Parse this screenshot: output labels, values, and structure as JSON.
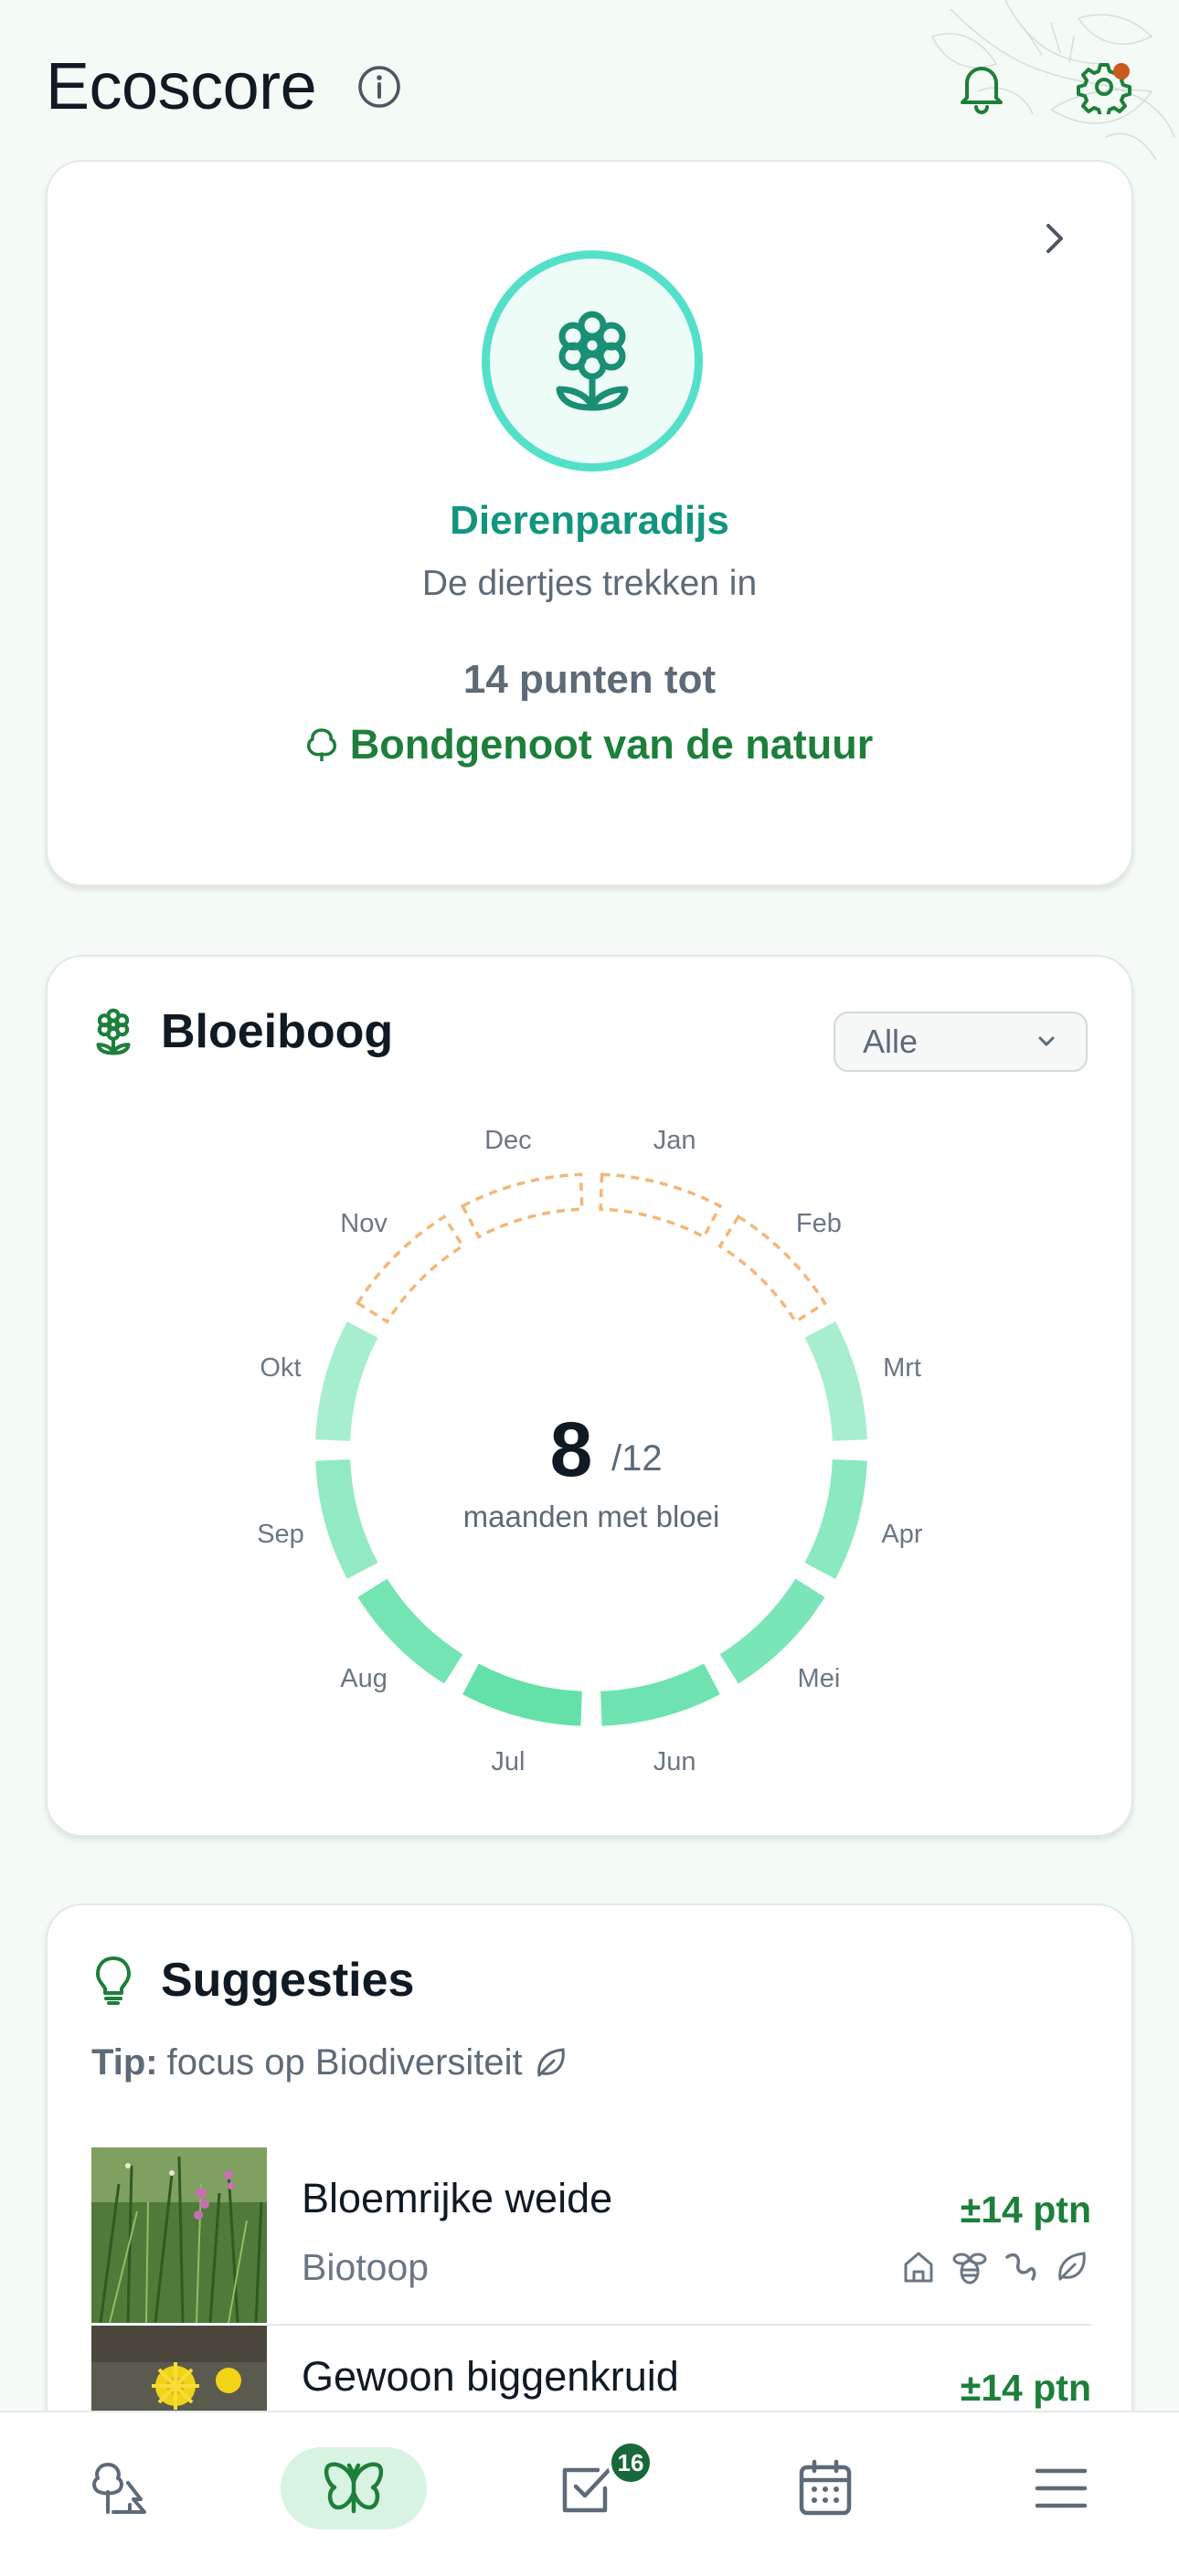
{
  "header": {
    "title": "Ecoscore",
    "icons": [
      "info-icon",
      "bell-icon",
      "gear-icon"
    ],
    "settings_has_notification": true
  },
  "level_card": {
    "icon": "flower-icon",
    "title": "Dierenparadijs",
    "subtitle": "De diertjes trekken in",
    "points_text": "14 punten tot",
    "next_level_icon": "tree-icon",
    "next_level": "Bondgenoot van de natuur"
  },
  "bloom_card": {
    "title": "Bloeiboog",
    "icon": "flower-icon",
    "filter_value": "Alle",
    "count": "8",
    "total": "/12",
    "caption": "maanden met bloei",
    "months": [
      {
        "label": "Jan",
        "bloom": false
      },
      {
        "label": "Feb",
        "bloom": false
      },
      {
        "label": "Mrt",
        "bloom": true,
        "level": 0.35
      },
      {
        "label": "Apr",
        "bloom": true,
        "level": 0.6
      },
      {
        "label": "Mei",
        "bloom": true,
        "level": 0.75
      },
      {
        "label": "Jun",
        "bloom": true,
        "level": 0.85
      },
      {
        "label": "Jul",
        "bloom": true,
        "level": 0.95
      },
      {
        "label": "Aug",
        "bloom": true,
        "level": 0.8
      },
      {
        "label": "Sep",
        "bloom": true,
        "level": 0.55
      },
      {
        "label": "Okt",
        "bloom": true,
        "level": 0.35
      },
      {
        "label": "Nov",
        "bloom": false
      },
      {
        "label": "Dec",
        "bloom": false
      }
    ],
    "colors": {
      "bloom": "#5ee0a6",
      "empty_dash": "#f3b777"
    }
  },
  "suggestions": {
    "title": "Suggesties",
    "tip_label": "Tip:",
    "tip_text": "focus op Biodiversiteit",
    "items": [
      {
        "name": "Bloemrijke weide",
        "type": "Biotoop",
        "points": "±14 ptn",
        "icons": [
          "house-icon",
          "bee-icon",
          "worm-icon",
          "leaf-icon"
        ]
      },
      {
        "name": "Gewoon biggenkruid",
        "type": "",
        "points": "±14 ptn",
        "icons": []
      }
    ]
  },
  "bottom_nav": {
    "items": [
      {
        "icon": "trees-icon",
        "active": false
      },
      {
        "icon": "butterfly-icon",
        "active": true
      },
      {
        "icon": "checkbox-icon",
        "active": false,
        "badge": "16"
      },
      {
        "icon": "calendar-icon",
        "active": false
      },
      {
        "icon": "menu-icon",
        "active": false
      }
    ]
  }
}
